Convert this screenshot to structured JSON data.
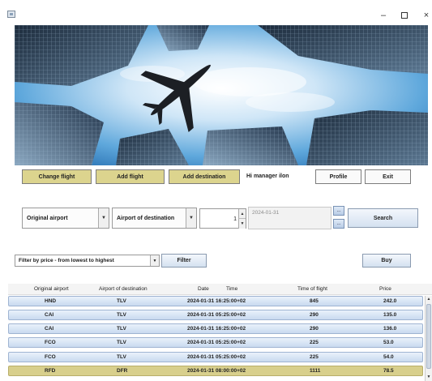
{
  "window": {
    "controls": {
      "minimize": "–",
      "maximize": "",
      "close": "×"
    }
  },
  "nav": {
    "change_flight": "Change flight",
    "add_flight": "Add flight",
    "add_destination": "Add destination",
    "greeting": "Hi manager ilon",
    "profile": "Profile",
    "exit": "Exit"
  },
  "search": {
    "origin_selected": "Original airport",
    "destination_selected": "Airport of destination",
    "passengers": "1",
    "date": "2024-01-31",
    "date_button": "...",
    "search_label": "Search"
  },
  "filter": {
    "selected": "Filter by price - from lowest to highest",
    "filter_label": "Filter",
    "buy_label": "Buy"
  },
  "table": {
    "headers": [
      "Original airport",
      "Airport of destination",
      "Date",
      "Time",
      "Time of flight",
      "Price"
    ],
    "rows": [
      {
        "origin": "HND",
        "destination": "TLV",
        "datetime": "2024-01-31 16:25:00+02",
        "duration": "845",
        "price": "242.0",
        "selected": false
      },
      {
        "origin": "CAI",
        "destination": "TLV",
        "datetime": "2024-01-31 05:25:00+02",
        "duration": "290",
        "price": "135.0",
        "selected": false
      },
      {
        "origin": "CAI",
        "destination": "TLV",
        "datetime": "2024-01-31 16:25:00+02",
        "duration": "290",
        "price": "136.0",
        "selected": false
      },
      {
        "origin": "FCO",
        "destination": "TLV",
        "datetime": "2024-01-31 05:25:00+02",
        "duration": "225",
        "price": "53.0",
        "selected": false
      },
      {
        "origin": "FCO",
        "destination": "TLV",
        "datetime": "2024-01-31 05:25:00+02",
        "duration": "225",
        "price": "54.0",
        "selected": false
      },
      {
        "origin": "RFD",
        "destination": "DFR",
        "datetime": "2024-01-31 08:00:00+02",
        "duration": "1111",
        "price": "78.5",
        "selected": true
      }
    ]
  },
  "colors": {
    "gold_button": "#dcd48e",
    "row_gradient_top": "#e9f1fb",
    "row_gradient_bottom": "#c9daf0",
    "selected_row": "#d8cf8c"
  },
  "icons": {
    "app": "app-window-icon",
    "plane": "airplane-silhouette",
    "dropdown": "chevron-down-icon",
    "spinner": "spinner-arrows-icon"
  }
}
